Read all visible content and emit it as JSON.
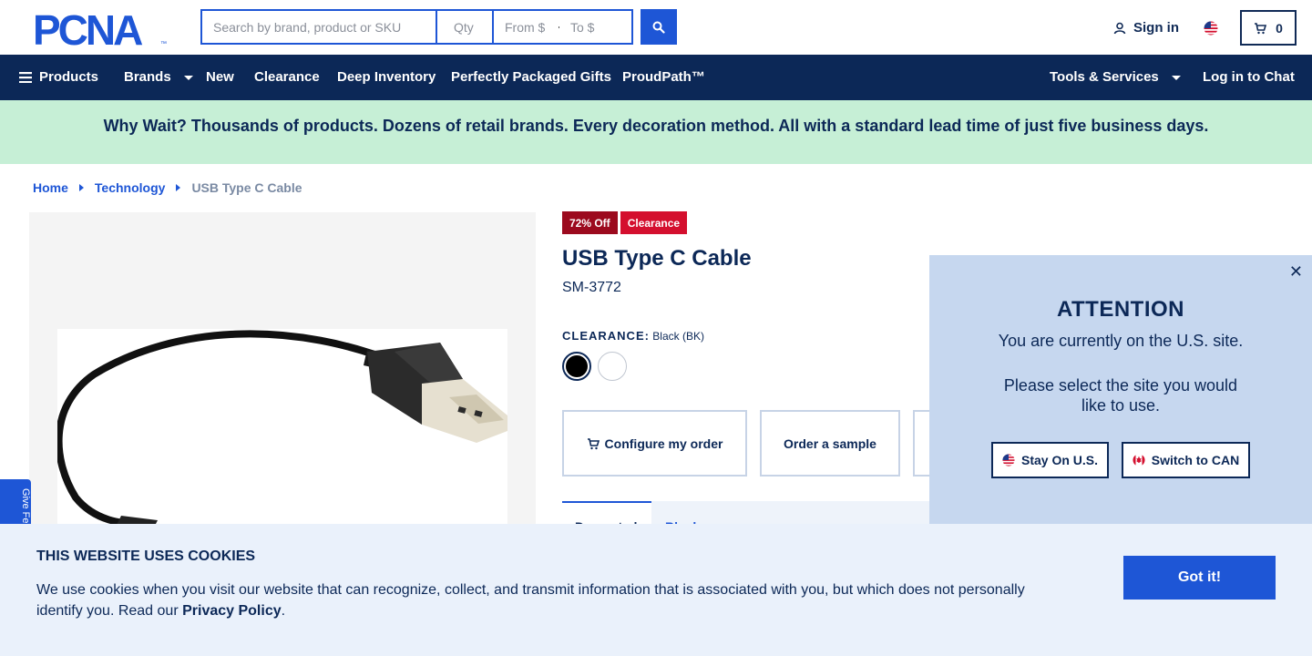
{
  "header": {
    "logo_text": "PCNA",
    "search_placeholder": "Search by brand, product or SKU",
    "qty_placeholder": "Qty",
    "price_from_placeholder": "From $",
    "price_to_placeholder": "To $",
    "signin_label": "Sign in",
    "cart_count": "0"
  },
  "nav": {
    "products": "Products",
    "brands": "Brands",
    "new": "New",
    "clearance": "Clearance",
    "deep_inventory": "Deep Inventory",
    "gifts": "Perfectly Packaged Gifts",
    "proudpath": "ProudPath™",
    "tools": "Tools & Services",
    "chat": "Log in to Chat"
  },
  "promo": {
    "text": "Why Wait? Thousands of products. Dozens of retail brands. Every decoration method. All with a standard lead time of just five business days."
  },
  "breadcrumb": {
    "home": "Home",
    "category": "Technology",
    "current": "USB Type C Cable"
  },
  "feedback": {
    "label": "Give Fe"
  },
  "product": {
    "badge_off": "72% Off",
    "badge_clearance": "Clearance",
    "title": "USB Type C Cable",
    "sku": "SM-3772",
    "color_key": "CLEARANCE:",
    "color_value": "Black (BK)",
    "swatches": [
      {
        "name": "Black",
        "color": "#000000"
      },
      {
        "name": "White",
        "color": "#ffffff"
      }
    ],
    "configure_label": "Configure my order",
    "sample_label": "Order a sample",
    "tabs": {
      "active": "Decorated",
      "inactive": "Blank"
    }
  },
  "region_modal": {
    "heading": "ATTENTION",
    "line1": "You are currently on the U.S. site.",
    "line2": "Please select the site you would",
    "line3": "like to use.",
    "stay_label": "Stay On U.S.",
    "switch_label": "Switch to CAN",
    "close_symbol": "✕"
  },
  "cookie": {
    "title": "THIS WEBSITE USES COOKIES",
    "text": "We use cookies when you visit our website that can recognize, collect, and transmit information that is associated with you, but which does not personally identify you. Read our ",
    "link": "Privacy Policy",
    "end": ".",
    "button": "Got it!"
  },
  "colors": {
    "navy": "#0c2857",
    "blue": "#1e56d6",
    "promo_green": "#c6efd6",
    "modal_blue": "#c6d7ef",
    "cookie_bg": "#eaf1fb",
    "badge_dark_red": "#9c0a1e",
    "badge_red": "#d40f2e"
  }
}
